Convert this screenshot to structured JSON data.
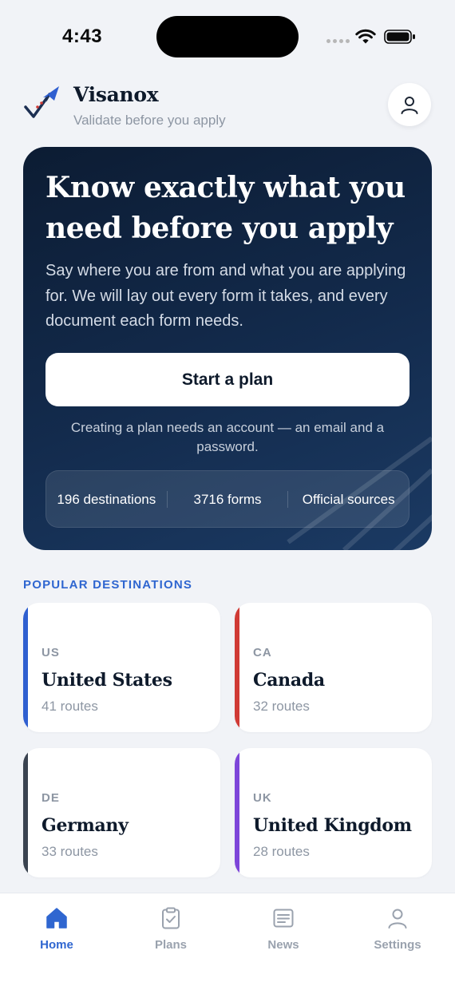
{
  "status_bar": {
    "time": "4:43"
  },
  "header": {
    "brand": "Visanox",
    "tagline": "Validate before you apply",
    "logo_icon": "plane-check-icon",
    "profile_icon": "user-icon"
  },
  "hero": {
    "title": "Know exactly what you need before you apply",
    "body": "Say where you are from and what you are applying for. We will lay out every form it takes, and every document each form needs.",
    "cta_label": "Start a plan",
    "note": "Creating a plan needs an account — an email and a password.",
    "stats": [
      {
        "label": "196 destinations"
      },
      {
        "label": "3716 forms"
      },
      {
        "label": "Official sources"
      }
    ]
  },
  "popular": {
    "heading": "POPULAR DESTINATIONS",
    "destinations": [
      {
        "code": "US",
        "name": "United States",
        "routes": "41 routes",
        "accent": "#2f5fd0"
      },
      {
        "code": "CA",
        "name": "Canada",
        "routes": "32 routes",
        "accent": "#d03a35"
      },
      {
        "code": "DE",
        "name": "Germany",
        "routes": "33 routes",
        "accent": "#3a4350"
      },
      {
        "code": "UK",
        "name": "United Kingdom",
        "routes": "28 routes",
        "accent": "#7d45d9"
      }
    ]
  },
  "tabs": [
    {
      "label": "Home",
      "icon": "home-icon",
      "active": true
    },
    {
      "label": "Plans",
      "icon": "clipboard-check-icon",
      "active": false
    },
    {
      "label": "News",
      "icon": "newspaper-icon",
      "active": false
    },
    {
      "label": "Settings",
      "icon": "user-icon",
      "active": false
    }
  ],
  "colors": {
    "accent": "#2f66d0",
    "hero_bg": "#0c1c33",
    "background": "#f1f3f7"
  }
}
